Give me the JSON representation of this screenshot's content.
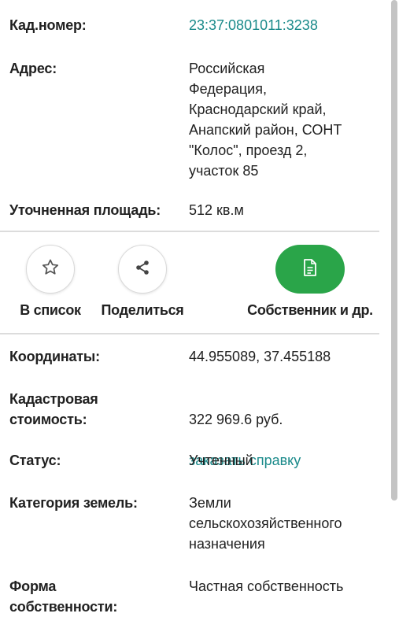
{
  "top_fields": [
    {
      "label": "Кад.номер:",
      "value": "23:37:0801011:3238",
      "is_link": true
    },
    {
      "label": "Адрес:",
      "value": "Российская\nФедерация,\nКраснодарский край,\nАнапский район, СОНТ\n\"Колос\", проезд 2,\nучасток 85"
    },
    {
      "label": "Уточненная площадь:",
      "value": "512 кв.м"
    }
  ],
  "actions": {
    "add_to_list": {
      "label": "В список",
      "icon": "star-icon"
    },
    "share": {
      "label": "Поделиться",
      "icon": "share-icon"
    },
    "owner": {
      "label": "Собственник и др.",
      "icon": "document-icon"
    }
  },
  "bottom_fields": {
    "coordinates": {
      "label": "Координаты:",
      "value": "44.955089, 37.455188"
    },
    "cadastral_value": {
      "label": "Кадастровая\nстоимость:",
      "value": "322 969.6 руб.",
      "link": "заказать справку"
    },
    "status": {
      "label": "Статус:",
      "value": "Учтенный"
    },
    "land_category": {
      "label": "Категория земель:",
      "value": "Земли\nсельскохозяйственного\nназначения"
    },
    "ownership": {
      "label": "Форма\nсобственности:",
      "value": "Частная собственность"
    }
  },
  "colors": {
    "accent_link": "#1a8a8a",
    "action_green": "#2aa549"
  }
}
